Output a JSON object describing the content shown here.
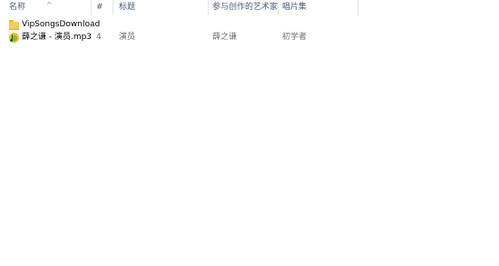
{
  "header": {
    "columns": [
      {
        "id": "name",
        "label": "名称"
      },
      {
        "id": "number",
        "label": "#"
      },
      {
        "id": "title",
        "label": "标题"
      },
      {
        "id": "artist",
        "label": "参与创作的艺术家"
      },
      {
        "id": "album",
        "label": "唱片集"
      }
    ],
    "sort_indicator": "^"
  },
  "rows": [
    {
      "icon": "folder-icon",
      "name": "VipSongsDownload",
      "number": "",
      "title": "",
      "artist": "",
      "album": ""
    },
    {
      "icon": "mp3-file-icon",
      "name": "薛之谦 - 演员.mp3",
      "number": "4",
      "title": "演员",
      "artist": "薛之谦",
      "album": "初学者"
    }
  ],
  "colors": {
    "header_text": "#4c607a",
    "folder": "#f6cc55",
    "separator": "#e5e5e5"
  }
}
